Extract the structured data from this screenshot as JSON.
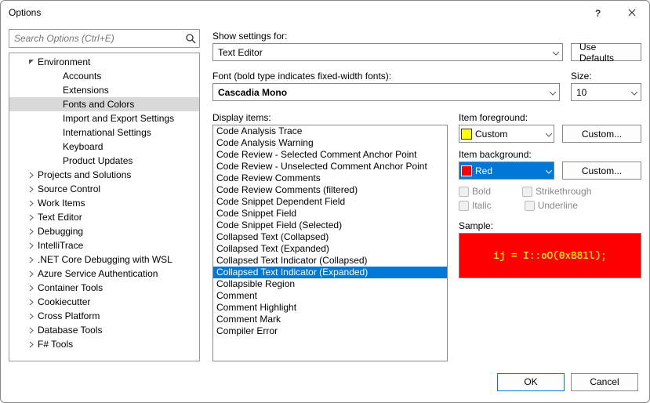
{
  "window": {
    "title": "Options"
  },
  "search": {
    "placeholder": "Search Options (Ctrl+E)"
  },
  "tree": [
    {
      "label": "Environment",
      "level": 1,
      "expanded": true
    },
    {
      "label": "Accounts",
      "level": 2
    },
    {
      "label": "Extensions",
      "level": 2
    },
    {
      "label": "Fonts and Colors",
      "level": 2,
      "selected": true
    },
    {
      "label": "Import and Export Settings",
      "level": 2
    },
    {
      "label": "International Settings",
      "level": 2
    },
    {
      "label": "Keyboard",
      "level": 2
    },
    {
      "label": "Product Updates",
      "level": 2
    },
    {
      "label": "Projects and Solutions",
      "level": 1,
      "expanded": false
    },
    {
      "label": "Source Control",
      "level": 1,
      "expanded": false
    },
    {
      "label": "Work Items",
      "level": 1,
      "expanded": false
    },
    {
      "label": "Text Editor",
      "level": 1,
      "expanded": false
    },
    {
      "label": "Debugging",
      "level": 1,
      "expanded": false
    },
    {
      "label": "IntelliTrace",
      "level": 1,
      "expanded": false
    },
    {
      "label": ".NET Core Debugging with WSL",
      "level": 1,
      "expanded": false
    },
    {
      "label": "Azure Service Authentication",
      "level": 1,
      "expanded": false
    },
    {
      "label": "Container Tools",
      "level": 1,
      "expanded": false
    },
    {
      "label": "Cookiecutter",
      "level": 1,
      "expanded": false
    },
    {
      "label": "Cross Platform",
      "level": 1,
      "expanded": false
    },
    {
      "label": "Database Tools",
      "level": 1,
      "expanded": false
    },
    {
      "label": "F# Tools",
      "level": 1,
      "expanded": false
    }
  ],
  "labels": {
    "show_settings_for": "Show settings for:",
    "use_defaults": "Use Defaults",
    "font_label": "Font (bold type indicates fixed-width fonts):",
    "size_label": "Size:",
    "display_items": "Display items:",
    "item_fg": "Item foreground:",
    "item_bg": "Item background:",
    "custom": "Custom...",
    "bold": "Bold",
    "strike": "Strikethrough",
    "italic": "Italic",
    "underline": "Underline",
    "sample": "Sample:",
    "ok": "OK",
    "cancel": "Cancel"
  },
  "values": {
    "show_settings_for": "Text Editor",
    "font": "Cascadia Mono",
    "size": "10",
    "fg_color_name": "Custom",
    "fg_color": "#ffff00",
    "bg_color_name": "Red",
    "bg_color": "#ff0000",
    "sample_text": "ij = I::oO(0xB81l);"
  },
  "display_items": [
    "Code Analysis Trace",
    "Code Analysis Warning",
    "Code Review - Selected Comment Anchor Point",
    "Code Review - Unselected Comment Anchor Point",
    "Code Review Comments",
    "Code Review Comments (filtered)",
    "Code Snippet Dependent Field",
    "Code Snippet Field",
    "Code Snippet Field (Selected)",
    "Collapsed Text (Collapsed)",
    "Collapsed Text (Expanded)",
    "Collapsed Text Indicator (Collapsed)",
    "Collapsed Text Indicator (Expanded)",
    "Collapsible Region",
    "Comment",
    "Comment Highlight",
    "Comment Mark",
    "Compiler Error"
  ],
  "display_selected": "Collapsed Text Indicator (Expanded)"
}
